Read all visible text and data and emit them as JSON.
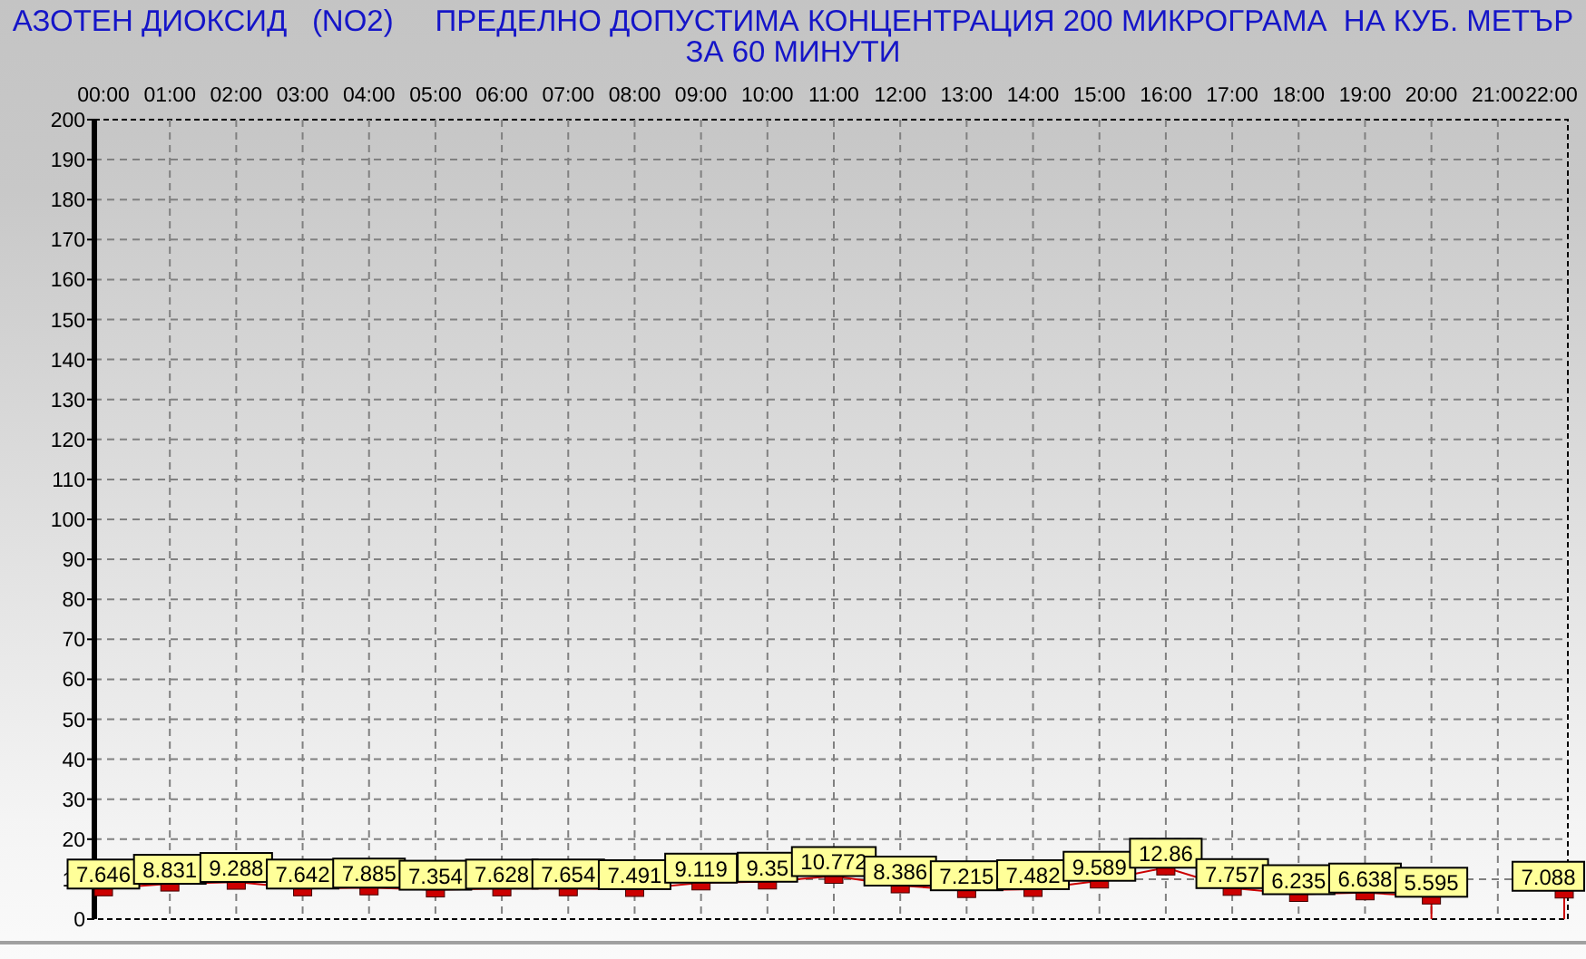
{
  "chart_data": {
    "type": "line",
    "title": "АЗОТЕН ДИОКСИД   (NO2)     ПРЕДЕЛНО ДОПУСТИМА КОНЦЕНТРАЦИЯ 200 МИКРОГРАМА  НА КУБ. МЕТЪР\nЗА 60 МИНУТИ",
    "categories": [
      "00:00",
      "01:00",
      "02:00",
      "03:00",
      "04:00",
      "05:00",
      "06:00",
      "07:00",
      "08:00",
      "09:00",
      "10:00",
      "11:00",
      "12:00",
      "13:00",
      "14:00",
      "15:00",
      "16:00",
      "17:00",
      "18:00",
      "19:00",
      "20:00",
      "21:00",
      "22:00"
    ],
    "grid": true,
    "series": [
      {
        "color": "#cc0000",
        "marker": "square",
        "values": [
          7.646,
          8.831,
          9.288,
          7.642,
          7.885,
          7.354,
          7.628,
          7.654,
          7.491,
          9.119,
          9.35,
          10.772,
          8.386,
          7.215,
          7.482,
          9.589,
          12.86,
          7.757,
          6.235,
          6.638,
          5.595,
          null,
          7.088
        ]
      }
    ],
    "ylim": [
      0,
      200
    ],
    "yticks": [
      0,
      10,
      20,
      30,
      40,
      50,
      60,
      70,
      80,
      90,
      100,
      110,
      120,
      130,
      140,
      150,
      160,
      170,
      180,
      190,
      200
    ],
    "data_labels": true
  }
}
